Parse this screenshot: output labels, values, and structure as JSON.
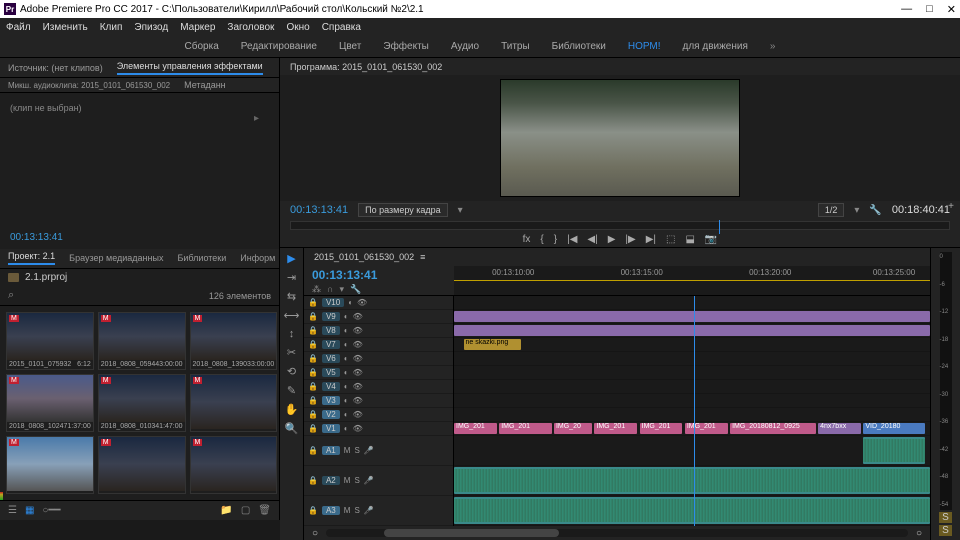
{
  "title": "Adobe Premiere Pro CC 2017 - C:\\Пользователи\\Кирилл\\Рабочий стол\\Кольский №2\\2.1",
  "menu": [
    "Файл",
    "Изменить",
    "Клип",
    "Эпизод",
    "Маркер",
    "Заголовок",
    "Окно",
    "Справка"
  ],
  "workspaces": {
    "items": [
      "Сборка",
      "Редактирование",
      "Цвет",
      "Эффекты",
      "Аудио",
      "Титры",
      "Библиотеки",
      "НОРМ!",
      "для движения"
    ],
    "active": "НОРМ!"
  },
  "source": {
    "tabs": [
      "Источник: (нет клипов)",
      "Элементы управления эффектами",
      "Микш. аудиоклипа: 2015_0101_061530_002",
      "Метаданн"
    ],
    "activeTab": "Элементы управления эффектами",
    "noclip": "(клип не выбран)",
    "tc": "00:13:13:41"
  },
  "project": {
    "tabs": [
      "Проект: 2.1",
      "Браузер медиаданных",
      "Библиотеки",
      "Информ"
    ],
    "activeTab": "Проект: 2.1",
    "bin": "2.1.prproj",
    "count": "126 элементов",
    "clips": [
      {
        "name": "2015_0101_075932",
        "dur": "6:12",
        "cls": ""
      },
      {
        "name": "2018_0808_05944",
        "dur": "3:00:00",
        "cls": ""
      },
      {
        "name": "2018_0808_13903",
        "dur": "3:00:00",
        "cls": ""
      },
      {
        "name": "2018_0808_10247",
        "dur": "1:37:00",
        "cls": "dusk"
      },
      {
        "name": "2018_0808_01034",
        "dur": "1:47:00",
        "cls": ""
      },
      {
        "name": "",
        "dur": "",
        "cls": ""
      },
      {
        "name": "",
        "dur": "",
        "cls": "day"
      },
      {
        "name": "",
        "dur": "",
        "cls": ""
      },
      {
        "name": "",
        "dur": "",
        "cls": ""
      }
    ]
  },
  "program": {
    "title": "Программа: 2015_0101_061530_002",
    "tc_in": "00:13:13:41",
    "fit": "По размеру кадра",
    "zoom": "1/2",
    "tc_out": "00:18:40:41"
  },
  "timeline": {
    "title": "2015_0101_061530_002",
    "tc": "00:13:13:41",
    "ruler": [
      "00:13:10:00",
      "00:13:15:00",
      "00:13:20:00",
      "00:13:25:00"
    ],
    "vtracks": [
      "V10",
      "V9",
      "V8",
      "V7",
      "V6",
      "V5",
      "V4",
      "V3",
      "V2",
      "V1"
    ],
    "atracks": [
      "A1",
      "A2",
      "A3"
    ],
    "v9_clip": "",
    "v7_label": "ne skazki.png",
    "v1_clips": [
      "IMG_201",
      "IMG_201",
      "IMG_20",
      "IMG_201",
      "IMG_201",
      "IMG_201",
      "IMG_20180812_0925",
      "4nx7bxx",
      "VID_20180"
    ]
  },
  "meters": {
    "labels": [
      "0",
      "-6",
      "-12",
      "-18",
      "-24",
      "-30",
      "-36",
      "-42",
      "-48",
      "-54"
    ],
    "solo": "S",
    "mute": "S"
  }
}
